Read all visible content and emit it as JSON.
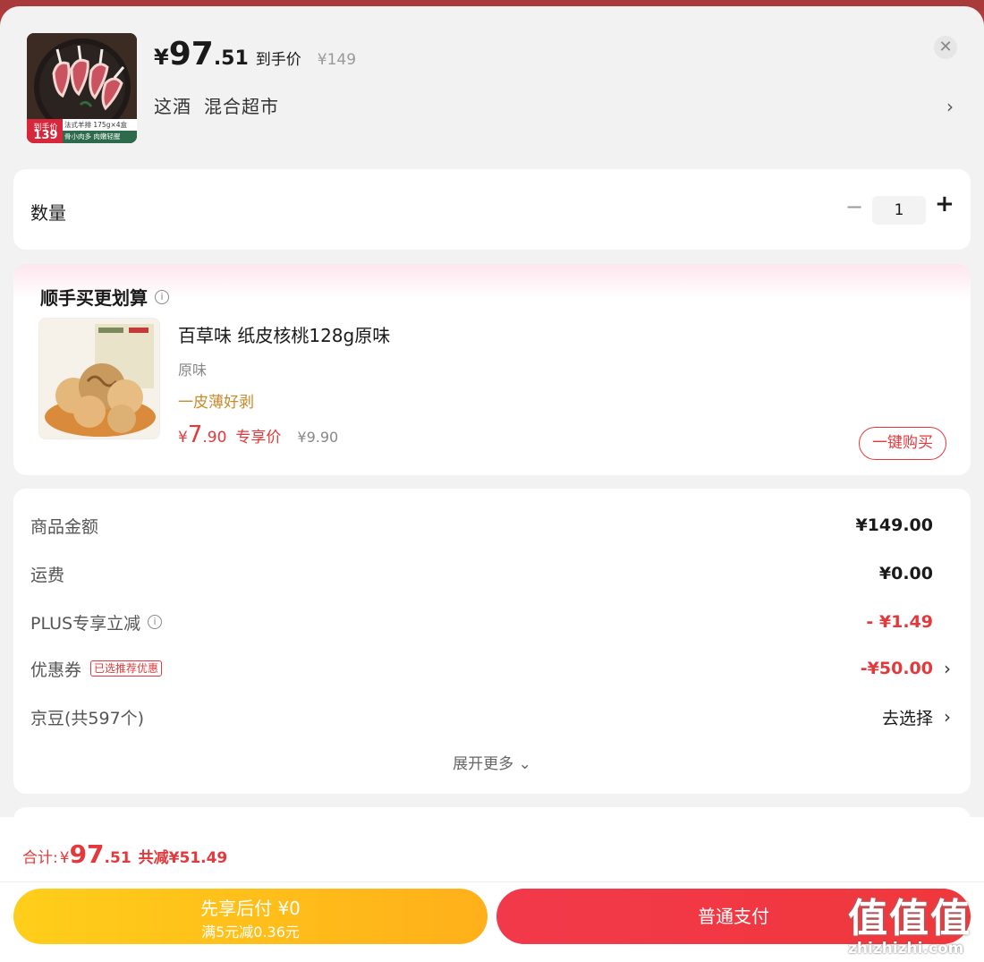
{
  "product": {
    "price_yen": "¥",
    "price_int": "97",
    "price_dec": ".51",
    "price_label": "到手价",
    "original_price": "¥149",
    "shop_name_1": "这酒",
    "shop_name_2": "混合超市",
    "thumb_badge_label": "到手价",
    "thumb_badge_price": "139",
    "thumb_caption_1": "法式羊排 175g×4盒",
    "thumb_caption_2": "骨小肉多 肉嫩轻腥"
  },
  "quantity": {
    "label": "数量",
    "minus": "−",
    "value": "1",
    "plus": "+"
  },
  "deal": {
    "title": "顺手买更划算",
    "info_icon": "i",
    "name": "百草味 纸皮核桃128g原味",
    "spec": "原味",
    "tag": "一皮薄好剥",
    "price_yen": "¥",
    "price_int": "7",
    "price_dec": ".90",
    "price_label": "专享价",
    "original_price": "¥9.90",
    "buy_button": "一键购买"
  },
  "summary": {
    "rows": [
      {
        "label": "商品金额",
        "value": "¥149.00"
      },
      {
        "label": "运费",
        "value": "¥0.00"
      },
      {
        "label": "PLUS专享立减",
        "value": "- ¥1.49"
      },
      {
        "label": "优惠券",
        "badge": "已选推荐优惠",
        "value": "-¥50.00"
      },
      {
        "label": "京豆(共597个)",
        "value": "去选择"
      }
    ],
    "expand": "展开更多 ⌄"
  },
  "footer": {
    "total_label": "合计:",
    "total_yen": "¥",
    "total_int": "97",
    "total_dec": ".51",
    "total_saved": "共减¥51.49",
    "pay_later_line1": "先享后付 ¥0",
    "pay_later_line2": "满5元减0.36元",
    "pay_now": "普通支付"
  },
  "watermark": {
    "big": "值值值",
    "small": "zhizhizhi.com"
  },
  "colors": {
    "accent_red": "#e4393c",
    "pay_later_yellow": "#ffc01a",
    "tag_gold": "#c88a2a"
  }
}
